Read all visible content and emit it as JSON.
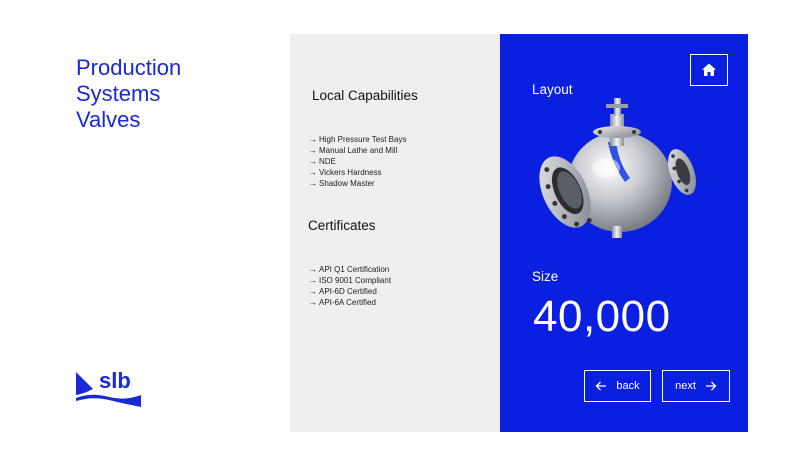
{
  "brand": {
    "title_lines": [
      "Production",
      "Systems",
      "Valves"
    ],
    "logo_text": "slb",
    "accent_color": "#1a28d6"
  },
  "capabilities": {
    "heading": "Local Capabilities",
    "items": [
      "High Pressure Test Bays",
      "Manual Lathe and Mill",
      "NDE",
      "Vickers Hardness",
      "Shadow Master"
    ]
  },
  "certificates": {
    "heading": "Certificates",
    "items": [
      "API Q1 Certification",
      "ISO 9001 Compliant",
      "API-6D Certified",
      "API-6A Certified"
    ]
  },
  "detail": {
    "panel_color": "#0a1fe0",
    "layout_label": "Layout",
    "size_label": "Size",
    "size_value": "40,000",
    "home_icon": "home-icon",
    "image_subject": "ball-valve-cutaway",
    "back_label": "back",
    "next_label": "next"
  },
  "icons": {
    "list_arrow": "→",
    "back_arrow": "arrow-left-icon",
    "next_arrow": "arrow-right-icon"
  }
}
